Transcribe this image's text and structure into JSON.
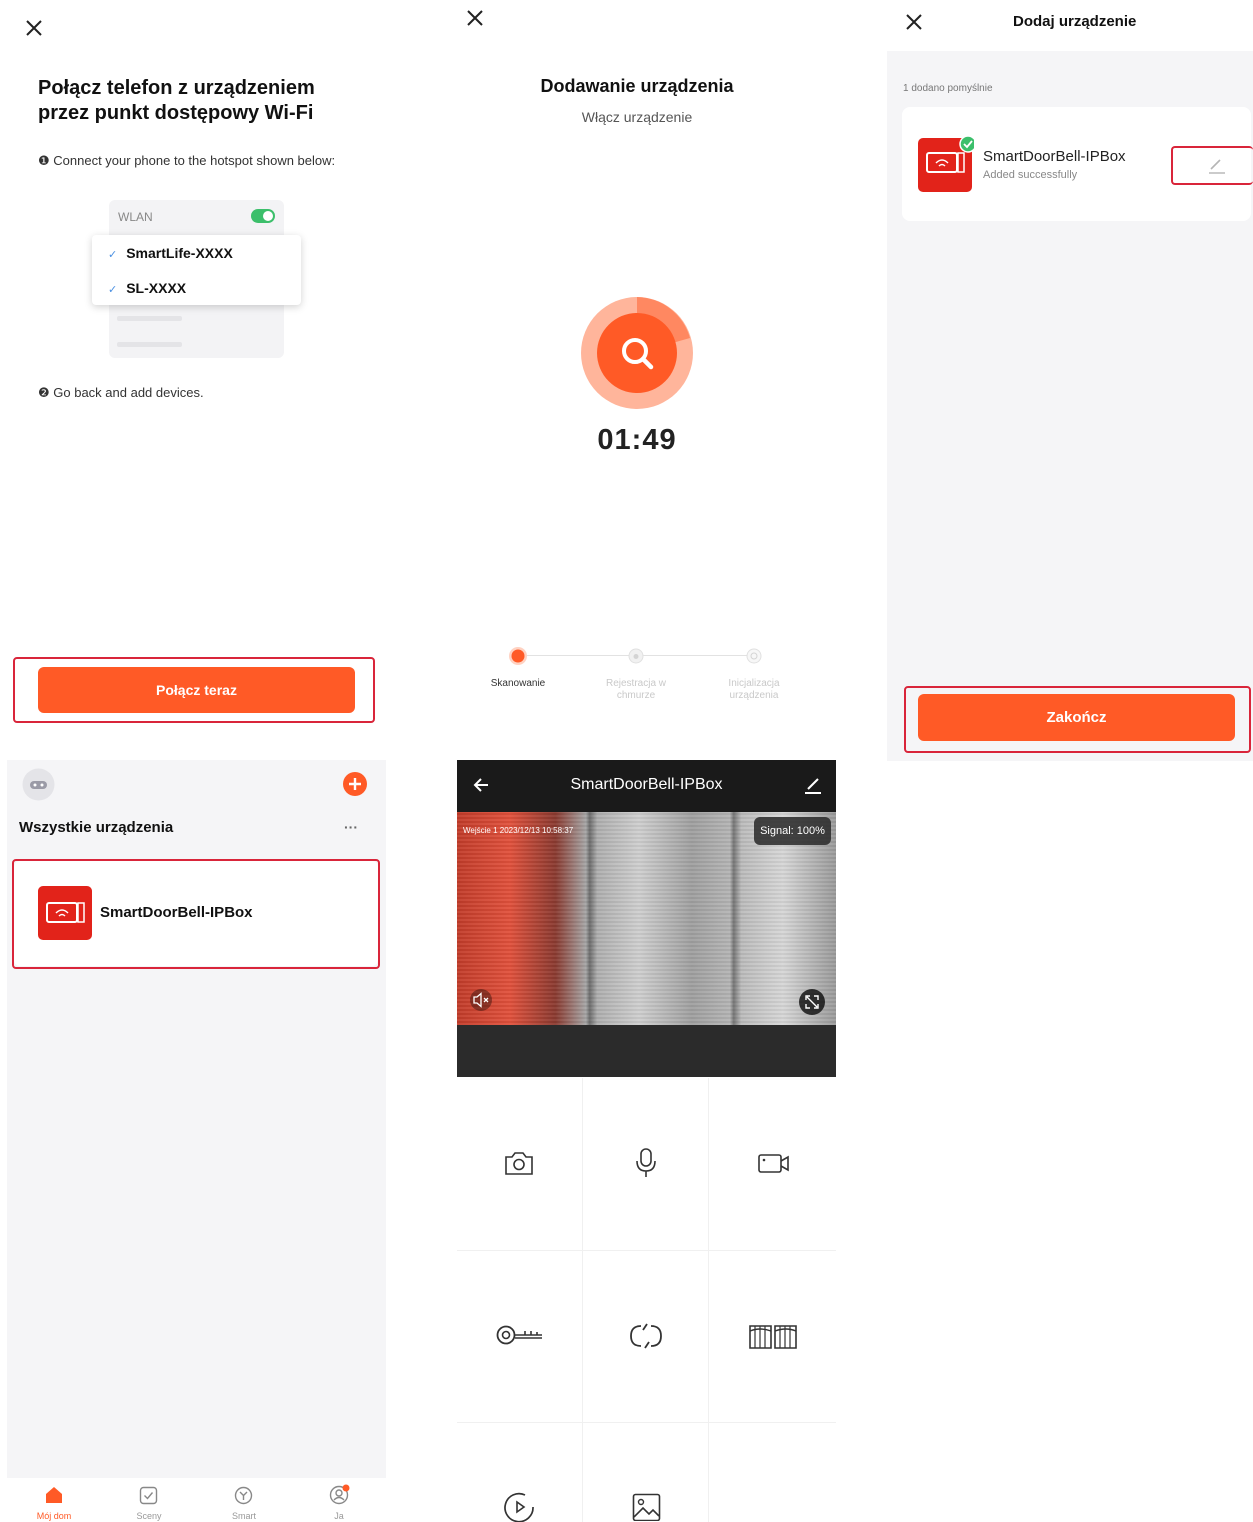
{
  "panel1": {
    "title": "Połącz telefon z urządzeniem przez punkt dostępowy Wi-Fi",
    "step1": "❶ Connect your phone to the hotspot shown below:",
    "wlan_label": "WLAN",
    "ssids": [
      "SmartLife-XXXX",
      "SL-XXXX"
    ],
    "step2": "❷ Go back and add devices.",
    "connect_button": "Połącz teraz"
  },
  "panel2": {
    "title": "Dodawanie urządzenia",
    "subtitle": "Włącz urządzenie",
    "timer": "01:49",
    "steps": [
      {
        "label": "Skanowanie",
        "state": "active"
      },
      {
        "label": "Rejestracja w chmurze",
        "state": "pending"
      },
      {
        "label": "Inicjalizacja urządzenia",
        "state": "pending"
      }
    ]
  },
  "panel3": {
    "title": "Dodaj urządzenie",
    "count_text": "1 dodano pomyślnie",
    "device_name": "SmartDoorBell-IPBox",
    "device_status": "Added successfully",
    "finish_button": "Zakończ"
  },
  "panel4": {
    "section_title": "Wszystkie urządzenia",
    "more": "···",
    "device_name": "SmartDoorBell-IPBox",
    "tabs": [
      "Mój dom",
      "Sceny",
      "Smart",
      "Ja"
    ]
  },
  "panel5": {
    "title": "SmartDoorBell-IPBox",
    "osd": "Wejście 1 2023/12/13  10:58:37",
    "signal": "Signal: 100%"
  },
  "colors": {
    "accent": "#ff5a26",
    "highlight_frame": "#d9253a",
    "device_icon": "#e2231a",
    "success": "#3cbf6b"
  }
}
